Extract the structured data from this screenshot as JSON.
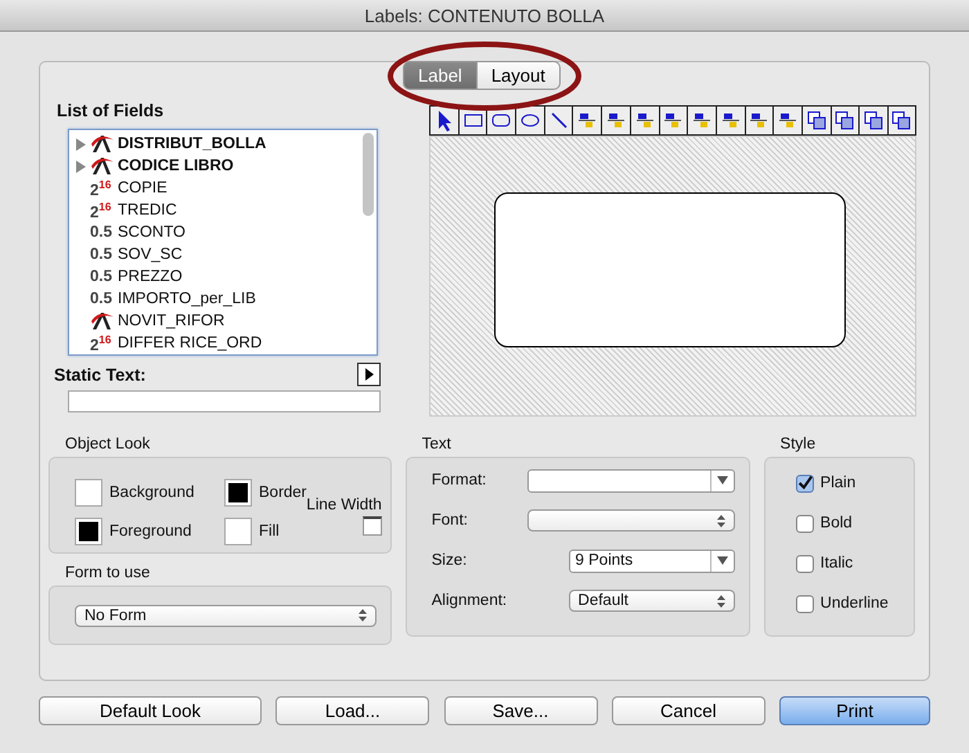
{
  "window": {
    "title": "Labels: CONTENUTO BOLLA"
  },
  "tabs": [
    {
      "label": "Label",
      "selected": true
    },
    {
      "label": "Layout",
      "selected": false
    }
  ],
  "fields": {
    "title": "List of Fields",
    "items": [
      {
        "name": "DISTRIBUT_BOLLA",
        "kind": "text",
        "expanded": false
      },
      {
        "name": "CODICE LIBRO",
        "kind": "text",
        "expanded": false
      },
      {
        "name": "COPIE",
        "kind": "number",
        "badge": "2$^{16}$"
      },
      {
        "name": "TREDIC",
        "kind": "number",
        "badge": "2$^{16}$"
      },
      {
        "name": "SCONTO",
        "kind": "number",
        "badge": "0.5"
      },
      {
        "name": "SOV_SC",
        "kind": "number",
        "badge": "0.5"
      },
      {
        "name": "PREZZO",
        "kind": "number",
        "badge": "0.5"
      },
      {
        "name": "IMPORTO_per_LIB",
        "kind": "number",
        "badge": "0.5"
      },
      {
        "name": "NOVIT_RIFOR",
        "kind": "text"
      },
      {
        "name": "DIFFER RICE_ORD",
        "kind": "number",
        "badge": "2$^{16}$"
      }
    ]
  },
  "static_text": {
    "label": "Static Text:"
  },
  "object_look": {
    "title": "Object Look",
    "swatches": [
      {
        "label": "Background",
        "color": "#ffffff"
      },
      {
        "label": "Border",
        "color": "#000000"
      },
      {
        "label": "Foreground",
        "color": "#000000"
      },
      {
        "label": "Fill",
        "color": "#ffffff"
      }
    ],
    "line_width_label": "Line Width"
  },
  "form_to_use": {
    "title": "Form to use",
    "value": "No Form"
  },
  "text": {
    "title": "Text",
    "rows": [
      {
        "label": "Format:",
        "kind": "combo"
      },
      {
        "label": "Font:",
        "kind": "popup"
      },
      {
        "label": "Size:",
        "kind": "combo",
        "value": "9 Points"
      },
      {
        "label": "Alignment:",
        "kind": "popup",
        "value": "Default"
      }
    ]
  },
  "style": {
    "title": "Style",
    "options": [
      {
        "label": "Plain",
        "checked": true
      },
      {
        "label": "Bold",
        "checked": false
      },
      {
        "label": "Italic",
        "checked": false
      },
      {
        "label": "Underline",
        "checked": false
      }
    ]
  },
  "buttons": [
    {
      "label": "Default Look",
      "default": false
    },
    {
      "label": "Load...",
      "default": false
    },
    {
      "label": "Save...",
      "default": false
    },
    {
      "label": "Cancel",
      "default": false
    },
    {
      "label": "Print",
      "default": true
    }
  ]
}
